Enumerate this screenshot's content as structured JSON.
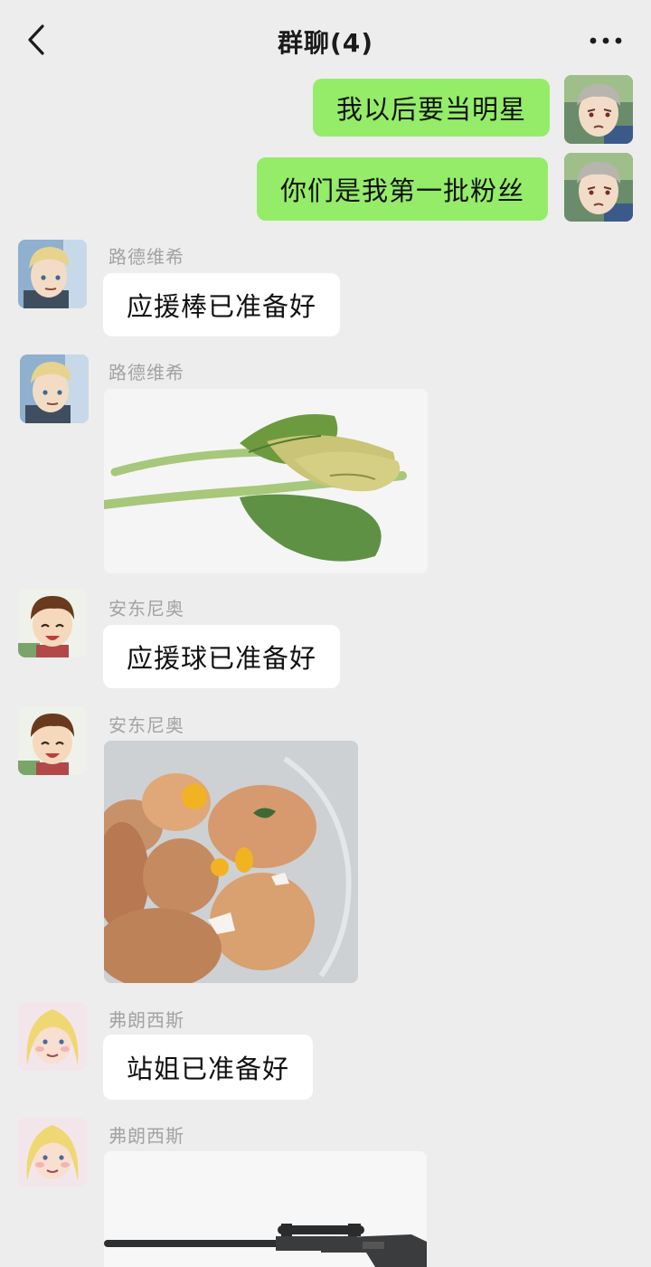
{
  "header": {
    "title": "群聊(4)",
    "back_icon": "chevron-left-icon",
    "more_icon": "more-dots-icon"
  },
  "messages": [
    {
      "side": "right",
      "text": "我以后要当明星"
    },
    {
      "side": "right",
      "text": "你们是我第一批粉丝"
    },
    {
      "side": "left",
      "sender": "路德维希",
      "text": "应援棒已准备好"
    },
    {
      "side": "left",
      "sender": "路德维希",
      "image": "wilted-vegetable-photo"
    },
    {
      "side": "left",
      "sender": "安东尼奥",
      "text": "应援球已准备好"
    },
    {
      "side": "left",
      "sender": "安东尼奥",
      "image": "tea-eggs-photo"
    },
    {
      "side": "left",
      "sender": "弗朗西斯",
      "text": "站姐已准备好"
    },
    {
      "side": "left",
      "sender": "弗朗西斯",
      "image": "sniper-rifle-photo"
    }
  ],
  "colors": {
    "background": "#ededed",
    "self_bubble": "#95ec69",
    "other_bubble": "#ffffff",
    "sender_name": "#a3a3a3"
  }
}
